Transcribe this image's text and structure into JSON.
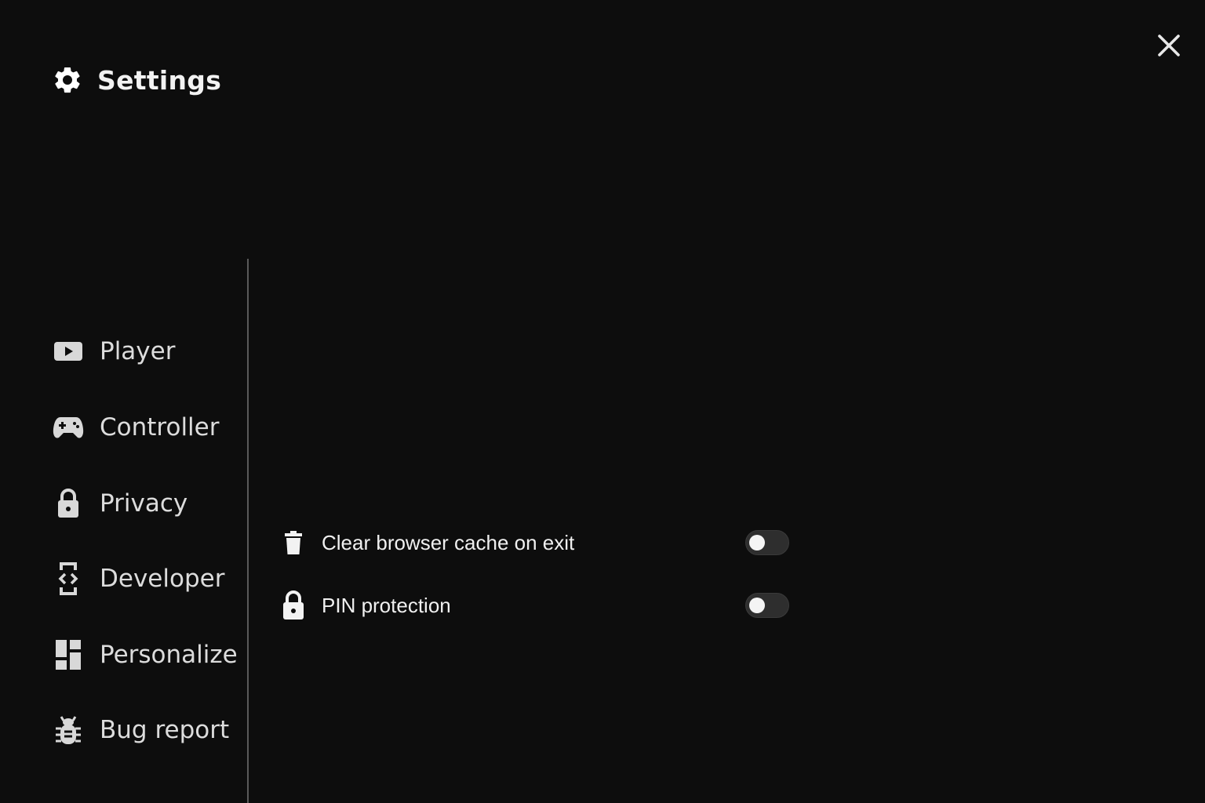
{
  "header": {
    "title": "Settings",
    "icon": "gear-icon"
  },
  "window": {
    "close_icon": "close-icon"
  },
  "sidebar": {
    "items": [
      {
        "label": "Player",
        "icon": "play-icon"
      },
      {
        "label": "Controller",
        "icon": "gamepad-icon"
      },
      {
        "label": "Privacy",
        "icon": "lock-icon"
      },
      {
        "label": "Developer",
        "icon": "developer-icon"
      },
      {
        "label": "Personalize",
        "icon": "dashboard-icon"
      },
      {
        "label": "Bug report",
        "icon": "bug-icon"
      }
    ]
  },
  "privacy": {
    "settings": [
      {
        "label": "Clear browser cache on exit",
        "icon": "trash-icon",
        "enabled": false
      },
      {
        "label": "PIN protection",
        "icon": "lock-icon",
        "enabled": false
      }
    ]
  },
  "colors": {
    "background": "#0d0d0d",
    "text": "#f0f0f0",
    "toggle_off": "#2e2e2e",
    "knob": "#f4f4f4"
  }
}
